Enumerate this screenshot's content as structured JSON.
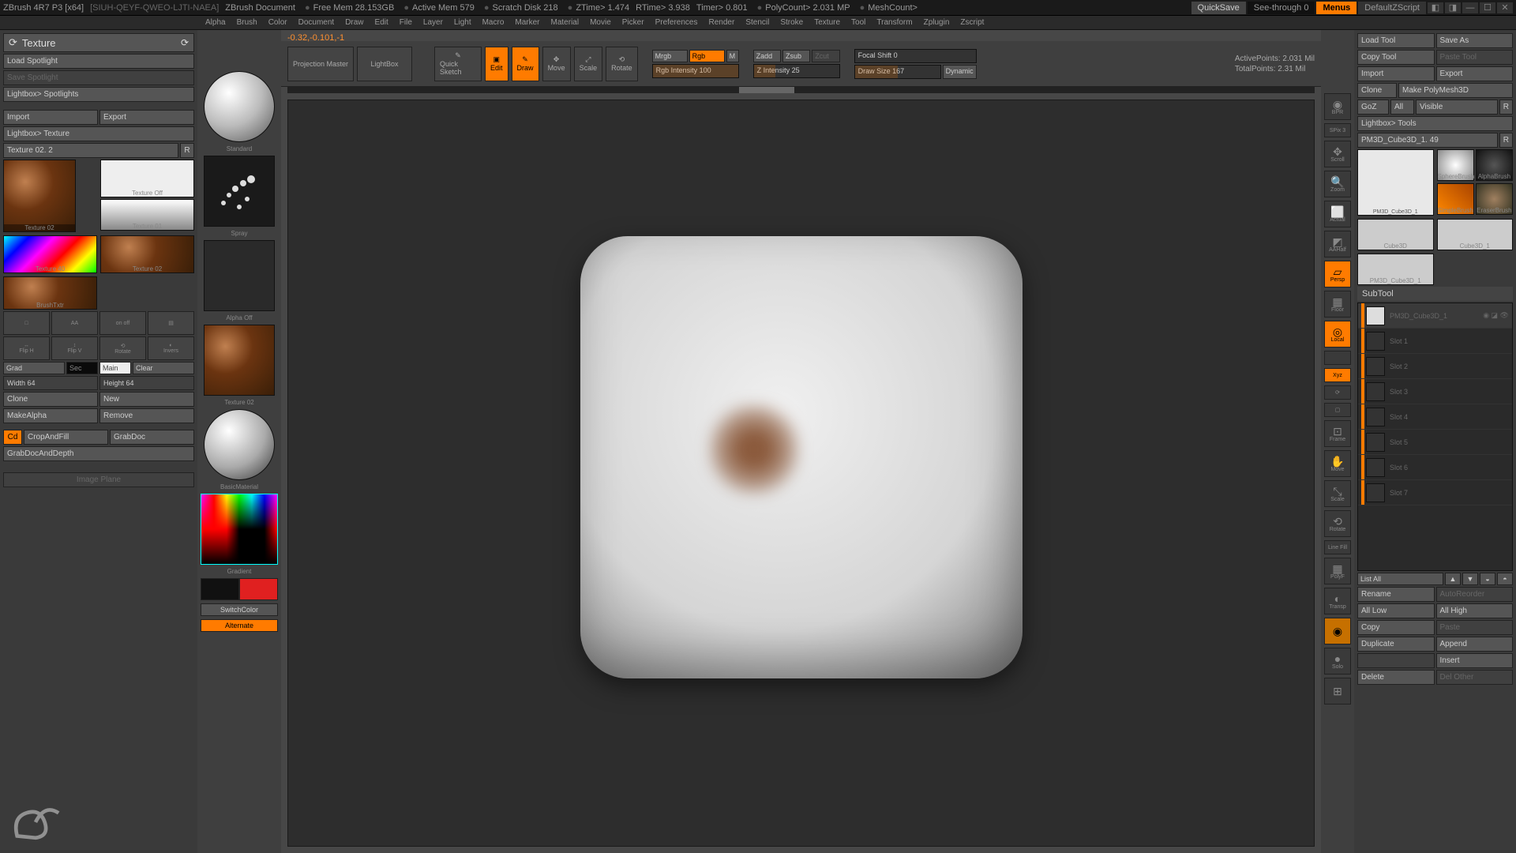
{
  "titlebar": {
    "app": "ZBrush 4R7 P3  [x64]",
    "docid": "[SIUH-QEYF-QWEO-LJTI-NAEA]",
    "doc": "ZBrush Document",
    "stats": {
      "freemem": "Free Mem 28.153GB",
      "activemem": "Active Mem 579",
      "scratch": "Scratch Disk 218",
      "ztime": "ZTime> 1.474",
      "rtime": "RTime> 3.938",
      "timer": "Timer> 0.801",
      "polycount": "PolyCount> 2.031 MP",
      "meshcount": "MeshCount>"
    },
    "quicksave": "QuickSave",
    "seethrough": "See-through  0",
    "menus": "Menus",
    "script": "DefaultZScript"
  },
  "menubar": [
    "Alpha",
    "Brush",
    "Color",
    "Document",
    "Draw",
    "Edit",
    "File",
    "Layer",
    "Light",
    "Macro",
    "Marker",
    "Material",
    "Movie",
    "Picker",
    "Preferences",
    "Render",
    "Stencil",
    "Stroke",
    "Texture",
    "Tool",
    "Transform",
    "Zplugin",
    "Zscript"
  ],
  "rightbtns": {
    "load": "Load Tool",
    "saveas": "Save As",
    "copy": "Copy Tool",
    "paste": "Paste Tool",
    "import": "Import",
    "export": "Export",
    "clone": "Clone",
    "makepoly": "Make PolyMesh3D",
    "goz": "GoZ",
    "all": "All",
    "visible": "Visible",
    "r": "R",
    "lightbox": "Lightbox> Tools"
  },
  "leftpanel": {
    "title": "Texture",
    "loadspot": "Load Spotlight",
    "savespot": "Save Spotlight",
    "libspot": "Lightbox> Spotlights",
    "import": "Import",
    "export": "Export",
    "libtex": "Lightbox> Texture",
    "texname": "Texture 02. 2",
    "r": "R",
    "thumbs": {
      "t1": "Texture 02",
      "toff": "Texture Off",
      "t01": "Texture 01",
      "t40": "Texture 40",
      "t02": "Texture 02",
      "brush": "BrushTxtr"
    },
    "flip": {
      "h": "Flip H",
      "v": "Flip V",
      "rot": "Rotate",
      "inv": "Invers"
    },
    "grad": "Grad",
    "sec": "Sec",
    "main": "Main",
    "clear": "Clear",
    "width": "Width 64",
    "height": "Height 64",
    "clone": "Clone",
    "new": "New",
    "makealpha": "MakeAlpha",
    "remove": "Remove",
    "cd": "Cd",
    "crop": "CropAndFill",
    "grab": "GrabDoc",
    "grabdepth": "GrabDocAndDepth",
    "imgplane": "Image Plane"
  },
  "midcol": {
    "standard": "Standard",
    "spray": "Spray",
    "alphaoff": "Alpha Off",
    "tex02": "Texture 02",
    "basicmat": "BasicMaterial",
    "gradient": "Gradient",
    "switch": "SwitchColor",
    "alt": "Alternate"
  },
  "canvastop": {
    "coord": "-0.32,-0.101,-1",
    "proj": "Projection Master",
    "lightbox": "LightBox",
    "quick": "Quick Sketch",
    "edit": "Edit",
    "draw": "Draw",
    "move": "Move",
    "scale": "Scale",
    "rotate": "Rotate",
    "mrgb": "Mrgb",
    "rgb": "Rgb",
    "m": "M",
    "rgbint": "Rgb Intensity 100",
    "zadd": "Zadd",
    "zsub": "Zsub",
    "zcut": "Zcut",
    "zint": "Z Intensity 25",
    "focal": "Focal Shift 0",
    "drawsize": "Draw Size 167",
    "dynamic": "Dynamic",
    "active": "ActivePoints: 2.031 Mil",
    "total": "TotalPoints: 2.31 Mil"
  },
  "navr": [
    "BPR",
    "SPix 3",
    "Scroll",
    "Zoom",
    "Actual",
    "AAHalf",
    "Persp",
    "Floor",
    "Local",
    "",
    "Xyz",
    "",
    "",
    "Frame",
    "Move",
    "Scale",
    "Rotate",
    "Line Fill",
    "PolyF",
    "Transp",
    "",
    "Solo",
    ""
  ],
  "rightcol": {
    "toolname": "PM3D_Cube3D_1. 49",
    "r": "R",
    "thumbs": {
      "t1": "PM3D_Cube3D_1",
      "t2": "SphereBrush",
      "t3": "AlphaBrush",
      "t4": "SimpleBrush",
      "t5": "EraserBrush",
      "t6": "Cube3D",
      "t7": "Cube3D_1",
      "t8": "PM3D_Cube3D_1"
    },
    "subtool": "SubTool",
    "active_item": "PM3D_Cube3D_1",
    "slots": [
      "Slot 1",
      "Slot 2",
      "Slot 3",
      "Slot 4",
      "Slot 5",
      "Slot 6",
      "Slot 7"
    ],
    "listall": "List All",
    "rename": "Rename",
    "autoreorder": "AutoReorder",
    "alllow": "All Low",
    "allhigh": "All High",
    "copy": "Copy",
    "paste": "Paste",
    "duplicate": "Duplicate",
    "append": "Append",
    "insert": "Insert",
    "delete": "Delete",
    "delother": "Del Other"
  }
}
